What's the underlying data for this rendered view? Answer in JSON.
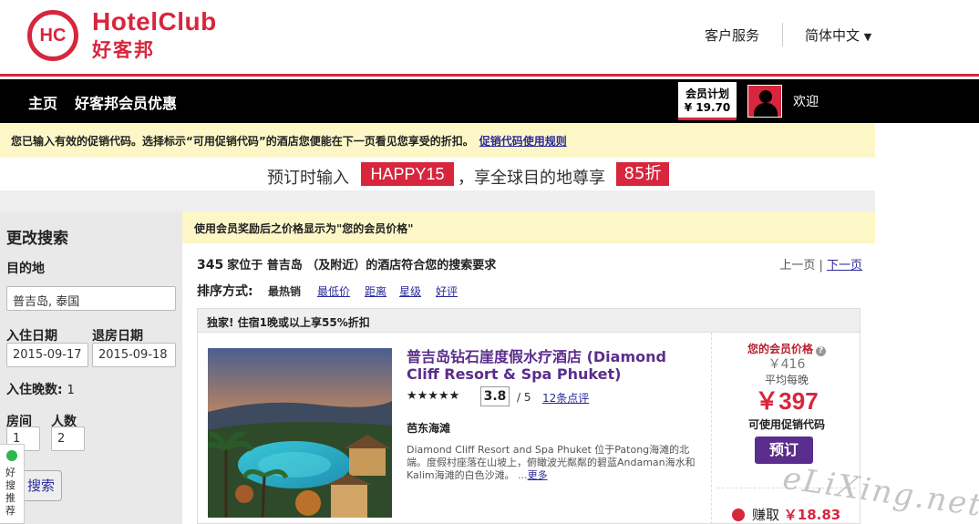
{
  "brand": {
    "logo_mark": "HC",
    "name": "HotelClub",
    "name_cn": "好客邦",
    "color": "#d7263d"
  },
  "header": {
    "customer_service": "客户服务",
    "language": "简体中文"
  },
  "nav": {
    "home": "主页",
    "member_offers": "好客邦会员优惠",
    "member_plan_label": "会员计划",
    "member_plan_value": "¥ 19.70",
    "welcome": "欢迎"
  },
  "promo_notice": {
    "text": "您已输入有效的促销代码。选择标示“可用促销代码”的酒店您便能在下一页看见您享受的折扣。",
    "rules_link": "促销代码使用规则"
  },
  "promo_banner": {
    "prefix": "预订时输入",
    "code": "HAPPY15",
    "middle": "，享全球目的地尊享",
    "discount": "85折"
  },
  "sidebar": {
    "title": "更改搜索",
    "destination_label": "目的地",
    "destination_value": "普吉岛, 泰国",
    "checkin_label": "入住日期",
    "checkin_value": "2015-09-17",
    "checkout_label": "退房日期",
    "checkout_value": "2015-09-18",
    "nights_label": "入住晚数:",
    "nights_value": "1",
    "rooms_label": "房间",
    "rooms_value": "1",
    "guests_label": "人数",
    "guests_value": "2",
    "search_button": "搜索",
    "widget_text": "好搜推荐"
  },
  "results": {
    "member_price_notice": "使用会员奖励后之价格显示为\"您的会员价格\"",
    "count": "345",
    "count_text": "家位于 普吉岛 （及附近）的酒店符合您的搜索要求",
    "prev_page": "上一页",
    "next_page": "下一页",
    "sort_label": "排序方式:",
    "sort_options": [
      "最热销",
      "最低价",
      "距离",
      "星级",
      "好评"
    ],
    "deal_banner": "独家! 住宿1晚或以上享55%折扣"
  },
  "hotel": {
    "name": "普吉岛钻石崖度假水疗酒店 (Diamond Cliff Resort & Spa Phuket)",
    "stars": "★★★★★",
    "rating": "3.8",
    "rating_scale": "/ 5",
    "reviews": "12条点评",
    "area": "芭东海滩",
    "description": "Diamond Cliff Resort and Spa Phuket 位于Patong海滩的北端。度假村座落在山坡上，俯瞰波光粼粼的碧蓝Andaman海水和Kalim海滩的白色沙滩。 ...",
    "more_link": "更多",
    "member_price_label": "您的会员价格",
    "original_price": "￥416",
    "avg_per_night": "平均每晚",
    "price": "￥397",
    "promo_available": "可使用促销代码",
    "book_button": "预订",
    "earn_label": "赚取",
    "earn_value": "￥18.83"
  },
  "watermark": "eLiXing.net"
}
